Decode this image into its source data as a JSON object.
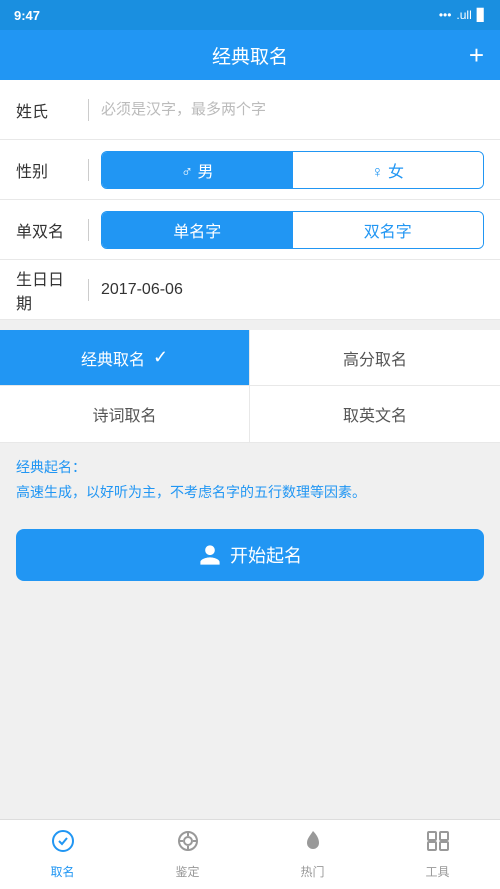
{
  "statusBar": {
    "time": "9:47",
    "icons": "... .ull ▊"
  },
  "header": {
    "title": "经典取名",
    "plusLabel": "+"
  },
  "form": {
    "surnameLabel": "姓氏",
    "surnamePlaceholder": "必须是汉字，最多两个字",
    "genderLabel": "性别",
    "genderMale": "♂ 男",
    "genderFemale": "♀ 女",
    "singleDoubleLabel": "单双名",
    "singleName": "单名字",
    "doubleName": "双名字",
    "birthdateLabel": "生日日期",
    "birthdateValue": "2017-06-06"
  },
  "categories": [
    {
      "id": "classic",
      "label": "经典取名",
      "active": true
    },
    {
      "id": "highscore",
      "label": "高分取名",
      "active": false
    },
    {
      "id": "poetry",
      "label": "诗词取名",
      "active": false
    },
    {
      "id": "english",
      "label": "取英文名",
      "active": false
    }
  ],
  "description": {
    "title": "经典起名：",
    "text": "高速生成，以好听为主，不考虑名字的五行数理等因素。"
  },
  "startButton": {
    "label": "开始起名"
  },
  "bottomNav": [
    {
      "id": "naming",
      "label": "取名",
      "active": true
    },
    {
      "id": "appraise",
      "label": "鉴定",
      "active": false
    },
    {
      "id": "hot",
      "label": "热门",
      "active": false
    },
    {
      "id": "tools",
      "label": "工具",
      "active": false
    }
  ]
}
